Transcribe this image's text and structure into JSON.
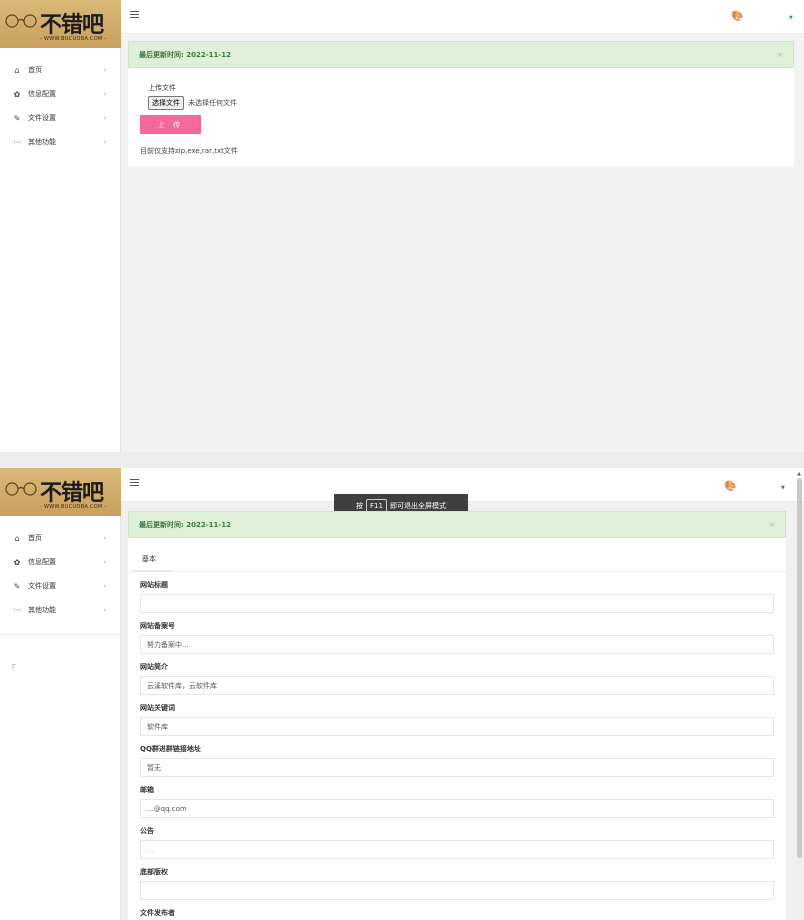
{
  "logo": {
    "brand": "不错吧",
    "url": "- WWW.BUCUOBA.COM -"
  },
  "sidebar": {
    "items": [
      {
        "label": "首页",
        "icon": "home-icon"
      },
      {
        "label": "信息配置",
        "icon": "gear-icon"
      },
      {
        "label": "文件设置",
        "icon": "pencil-icon"
      },
      {
        "label": "其他功能",
        "icon": "more-icon"
      }
    ],
    "stray": "Γ"
  },
  "alert": {
    "text": "最后更新时间: 2022-11-12",
    "close": "×"
  },
  "upload": {
    "title": "上传文件",
    "choose_label": "选择文件",
    "no_file": "未选择任何文件",
    "submit_label": "上 传",
    "hint": "目前仅支持zip,exe,rar,txt文件"
  },
  "toast": {
    "prefix": "按",
    "key": "F11",
    "suffix": "即可退出全屏模式"
  },
  "tabs": [
    {
      "label": "基本"
    }
  ],
  "form": {
    "fields": [
      {
        "label": "网站标题",
        "value": ""
      },
      {
        "label": "网站备案号",
        "value": "努力备案中..."
      },
      {
        "label": "网站简介",
        "value": "云溪软件库，云软件库"
      },
      {
        "label": "网站关键词",
        "value": "软件库"
      },
      {
        "label": "QQ群进群链接地址",
        "value": "暂无"
      },
      {
        "label": "邮箱",
        "value": "...@qq.com"
      },
      {
        "label": "公告",
        "value": "..."
      },
      {
        "label": "底部版权",
        "value": ""
      },
      {
        "label": "文件发布者",
        "value": ""
      }
    ]
  },
  "colors": {
    "accent": "#f6689c",
    "alert_bg": "#dff0d8",
    "alert_text": "#3c763d",
    "logo_bg": "#c9a05c"
  }
}
